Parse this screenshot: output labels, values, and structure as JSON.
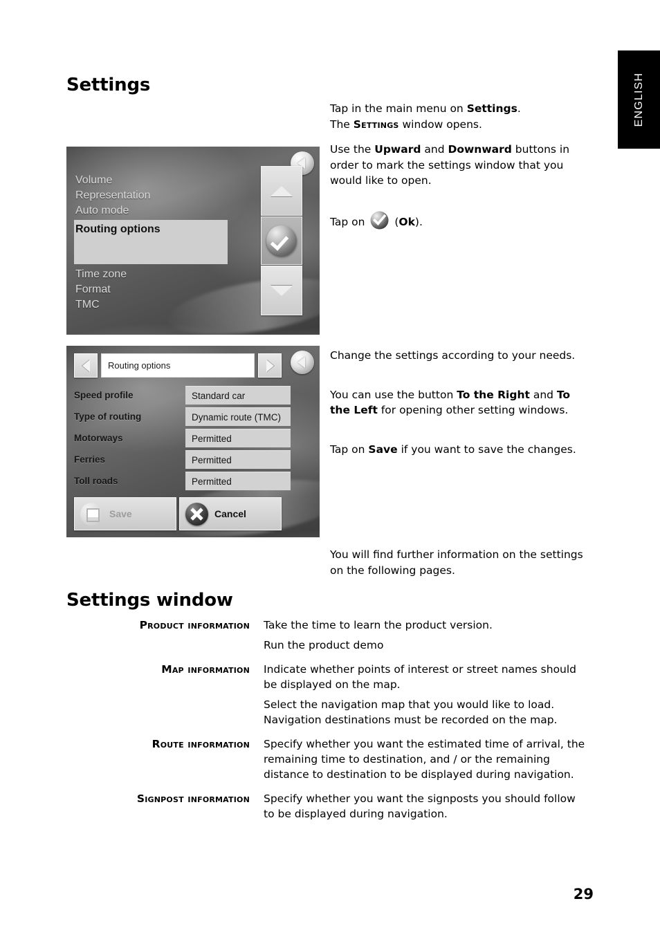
{
  "language_tab": {
    "label": "ENGLISH"
  },
  "page": {
    "number": "29"
  },
  "headings": {
    "title": "Settings",
    "section": "Settings window"
  },
  "instructions": {
    "block_a": {
      "line1_pre": "Tap in the main menu on ",
      "line1_bold": "Settings",
      "line1_post": ".",
      "line2_pre": "The ",
      "line2_smallcaps": "Settings",
      "line2_post": " window opens.",
      "line3_pre": "Use the ",
      "line3_bold1": "Upward",
      "line3_mid": " and ",
      "line3_bold2": "Downward",
      "line3_post": " buttons in order to mark the settings window that you would like to open.",
      "line4_pre": "Tap on ",
      "line4_icon": "ok-check-icon",
      "line4_mid": " (",
      "line4_bold": "Ok",
      "line4_post": ")."
    },
    "block_b": {
      "line1": "Change the settings according to your needs.",
      "line2_pre": "You can use the button ",
      "line2_bold1": "To the Right",
      "line2_mid": " and ",
      "line2_bold2": "To the Left",
      "line2_post": " for opening other setting windows.",
      "line3_pre": "Tap on ",
      "line3_bold": "Save",
      "line3_post": " if you want to save the changes."
    },
    "block_c": {
      "line1": "You will find further information on the settings on the following pages."
    }
  },
  "screenshot_settings": {
    "back_button_icon": "back-arrow-icon",
    "list_items": [
      "Volume",
      "Representation",
      "Auto mode"
    ],
    "selected_item": "Routing options",
    "list_items_after": [
      "Time zone",
      "Format",
      "TMC"
    ],
    "buttons": {
      "up_icon": "triangle-up-icon",
      "ok_icon": "check-icon",
      "down_icon": "triangle-down-icon"
    }
  },
  "screenshot_routing": {
    "back_button_icon": "back-arrow-icon",
    "prev_icon": "triangle-left-icon",
    "next_icon": "triangle-right-icon",
    "title": "Routing options",
    "rows": [
      {
        "label": "Speed profile",
        "value": "Standard car"
      },
      {
        "label": "Type of routing",
        "value": "Dynamic route (TMC)"
      },
      {
        "label": "Motorways",
        "value": "Permitted"
      },
      {
        "label": "Ferries",
        "value": "Permitted"
      },
      {
        "label": "Toll roads",
        "value": "Permitted"
      }
    ],
    "save_label": "Save",
    "save_icon": "floppy-disk-icon",
    "cancel_label": "Cancel",
    "cancel_icon": "close-x-icon"
  },
  "settings_window_list": [
    {
      "term": "Product information",
      "paragraphs": [
        "Take the time to learn the product version.",
        "Run the product demo"
      ]
    },
    {
      "term": "Map information",
      "paragraphs": [
        "Indicate whether points of interest or street names should be displayed on the map.",
        "Select the navigation map that you would like to load. Navigation destinations must be recorded on the map."
      ]
    },
    {
      "term": "Route information",
      "paragraphs": [
        "Specify whether you want the estimated time of arrival, the remaining time to destination, and / or the remaining distance to destination to be displayed during navigation."
      ]
    },
    {
      "term": "Signpost information",
      "paragraphs": [
        "Specify whether you want the signposts you should follow to be displayed during navigation."
      ]
    }
  ]
}
